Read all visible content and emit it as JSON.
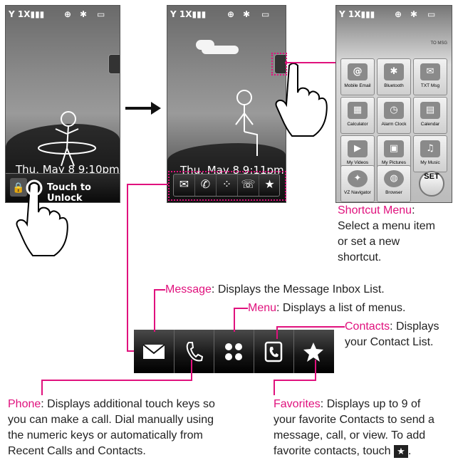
{
  "colors": {
    "accent": "#e0117d"
  },
  "screen1": {
    "date_text": "Thu, May 8 9:10pm",
    "unlock_label": "Touch to Unlock"
  },
  "screen2": {
    "date_text": "Thu, May 8 9:11pm"
  },
  "screen3": {
    "top_label": "TO MSG",
    "tiles": [
      {
        "label": "Mobile Email",
        "icon": "mail-icon"
      },
      {
        "label": "Bluetooth",
        "icon": "bluetooth-icon"
      },
      {
        "label": "TXT Msg",
        "icon": "message-icon"
      },
      {
        "label": "Calculator",
        "icon": "calculator-icon"
      },
      {
        "label": "Alarm Clock",
        "icon": "alarm-clock-icon"
      },
      {
        "label": "Calendar",
        "icon": "calendar-icon"
      },
      {
        "label": "My Videos",
        "icon": "film-icon"
      },
      {
        "label": "My Pictures",
        "icon": "picture-icon"
      },
      {
        "label": "My Music",
        "icon": "music-icon"
      },
      {
        "label": "VZ Navigator",
        "icon": "compass-icon"
      },
      {
        "label": "Browser",
        "icon": "globe-icon"
      },
      {
        "label": "SET",
        "icon": "set-button"
      }
    ]
  },
  "callouts": {
    "shortcut": {
      "title": "Shortcut Menu",
      "body1": "Select a menu item",
      "body2": "or set a new",
      "body3": "shortcut."
    },
    "message": {
      "title": "Message",
      "body": ": Displays the Message Inbox List."
    },
    "menu": {
      "title": "Menu",
      "body": ": Displays a list of menus."
    },
    "contacts": {
      "title": "Contacts",
      "body1": ": Displays",
      "body2": "your Contact List."
    },
    "phone": {
      "title": "Phone",
      "body1": ": Displays additional touch keys so",
      "body2": "you can make a call. Dial manually using",
      "body3": "the numeric keys or automatically from",
      "body4": "Recent Calls and Contacts."
    },
    "favorites": {
      "title": "Favorites",
      "body1": ": Displays up to 9 of",
      "body2": "your favorite Contacts to send a",
      "body3": "message, call, or view. To add",
      "body4": "favorite contacts, touch"
    }
  }
}
